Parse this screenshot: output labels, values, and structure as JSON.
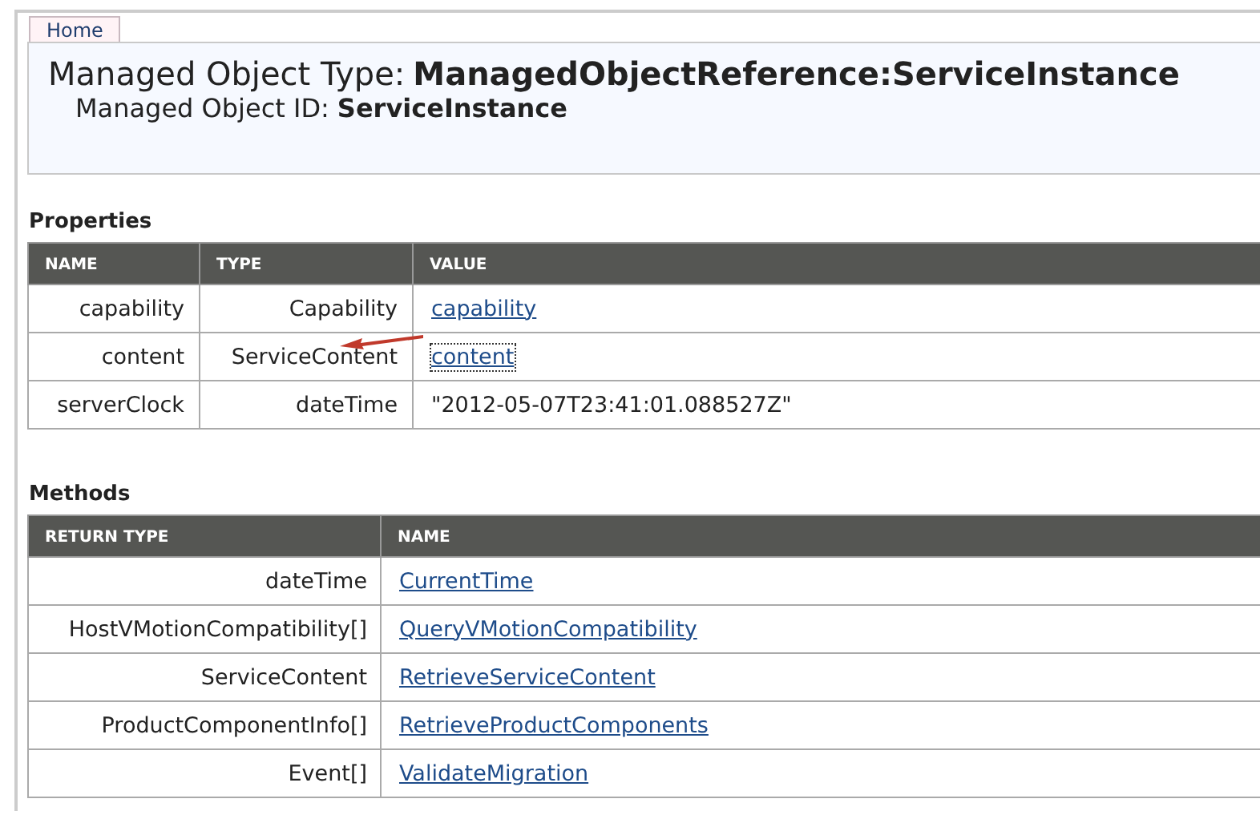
{
  "tabs": [
    {
      "label": "Home",
      "selected": true
    }
  ],
  "header": {
    "type_label": "Managed Object Type:",
    "type_value": "ManagedObjectReference:ServiceInstance",
    "id_label": "Managed Object ID:",
    "id_value": "ServiceInstance"
  },
  "properties": {
    "title": "Properties",
    "columns": [
      "NAME",
      "TYPE",
      "VALUE"
    ],
    "rows": [
      {
        "name": "capability",
        "type": "Capability",
        "value": "capability",
        "kind": "link"
      },
      {
        "name": "content",
        "type": "ServiceContent",
        "value": "content",
        "kind": "link",
        "focused": true
      },
      {
        "name": "serverClock",
        "type": "dateTime",
        "value": "\"2012-05-07T23:41:01.088527Z\"",
        "kind": "text"
      }
    ]
  },
  "methods": {
    "title": "Methods",
    "columns": [
      "RETURN TYPE",
      "NAME"
    ],
    "rows": [
      {
        "return_type": "dateTime",
        "name": "CurrentTime"
      },
      {
        "return_type": "HostVMotionCompatibility[]",
        "name": "QueryVMotionCompatibility"
      },
      {
        "return_type": "ServiceContent",
        "name": "RetrieveServiceContent"
      },
      {
        "return_type": "ProductComponentInfo[]",
        "name": "RetrieveProductComponents"
      },
      {
        "return_type": "Event[]",
        "name": "ValidateMigration"
      }
    ]
  }
}
